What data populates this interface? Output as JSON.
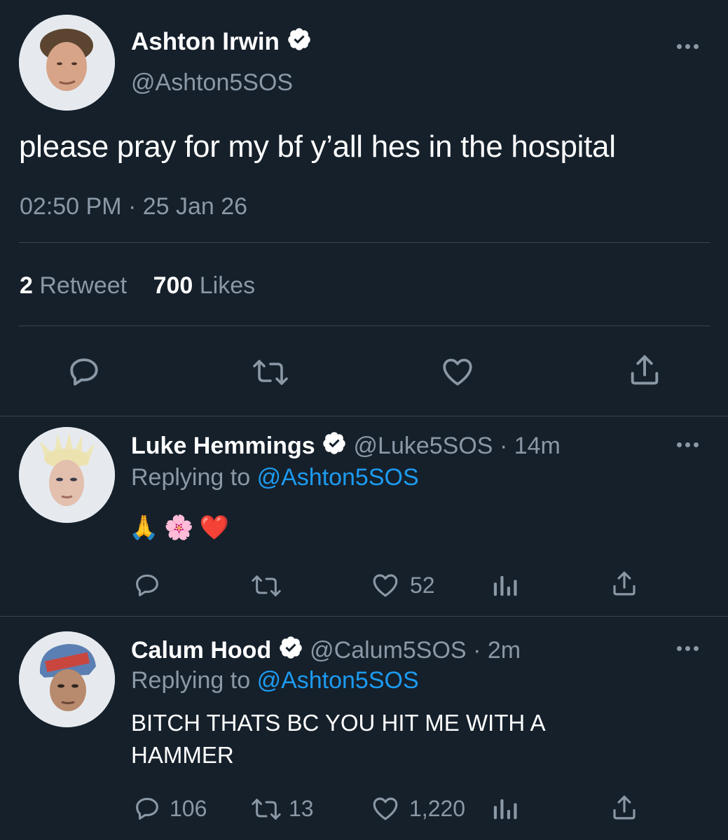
{
  "main_tweet": {
    "author_name": "Ashton Irwin",
    "author_handle": "@Ashton5SOS",
    "text": "please pray for my bf y’all hes in the hospital",
    "timestamp": "02:50 PM · 25 Jan 26",
    "retweet_count": "2",
    "retweet_label": "Retweet",
    "like_count": "700",
    "like_label": "Likes"
  },
  "replies": [
    {
      "author_name": "Luke Hemmings",
      "author_handle": "@Luke5SOS",
      "time": "· 14m",
      "replying_label": "Replying to",
      "replying_handle": "@Ashton5SOS",
      "text": "🙏🌸❤️",
      "reply_count": "",
      "retweet_count": "",
      "like_count": "52"
    },
    {
      "author_name": "Calum Hood",
      "author_handle": "@Calum5SOS",
      "time": "· 2m",
      "replying_label": "Replying to",
      "replying_handle": "@Ashton5SOS",
      "text_line1": "BITCH THATS BC YOU HIT ME WITH A",
      "text_line2": "HAMMER",
      "reply_count": "106",
      "retweet_count": "13",
      "like_count": "1,220"
    }
  ],
  "icons": [
    "reply-icon",
    "retweet-icon",
    "like-icon",
    "share-icon",
    "analytics-icon",
    "more-icon",
    "verified-icon"
  ],
  "colors": {
    "background": "#15202b",
    "text": "#ffffff",
    "muted": "#8b98a5",
    "link": "#1d9bf0",
    "divider": "#38444d"
  }
}
